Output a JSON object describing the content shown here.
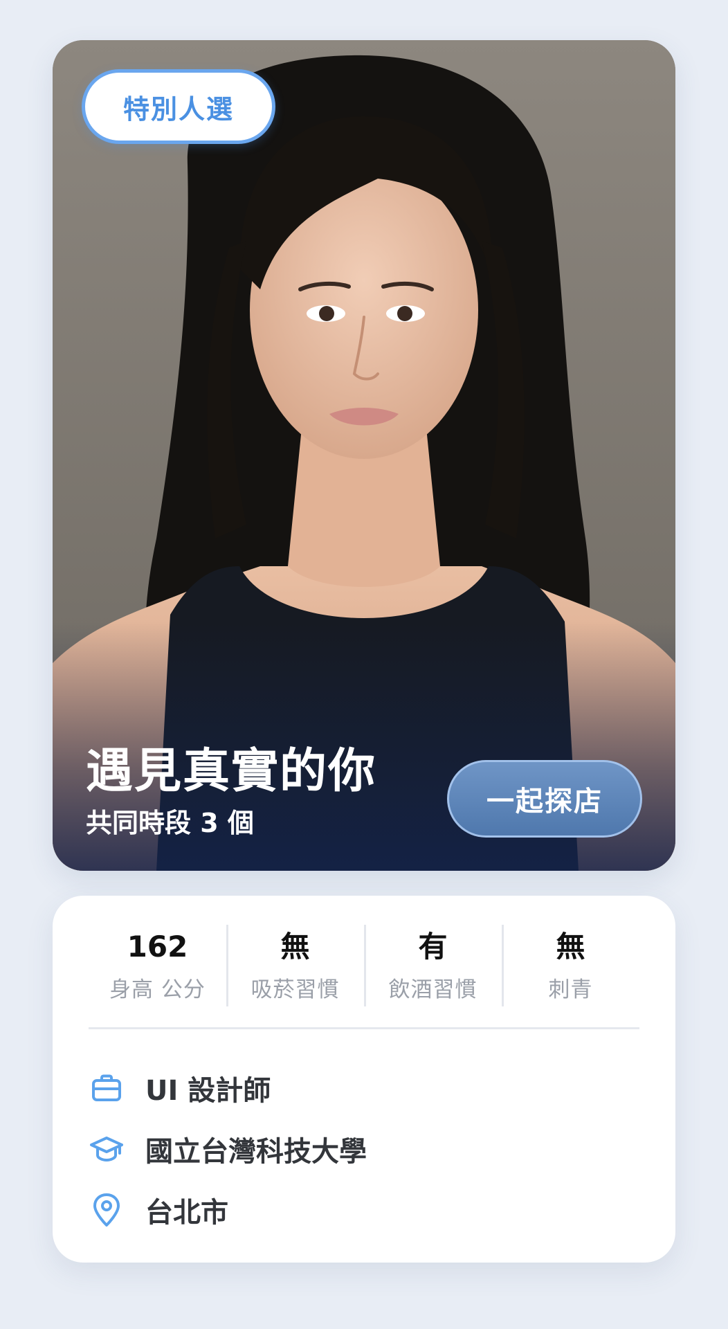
{
  "photo_card": {
    "badge_label": "特別人選",
    "headline": "遇見真實的你",
    "subline": "共同時段 3 個",
    "cta_label": "一起探店"
  },
  "stats": [
    {
      "value": "162",
      "label": "身高 公分"
    },
    {
      "value": "無",
      "label": "吸菸習慣"
    },
    {
      "value": "有",
      "label": "飲酒習慣"
    },
    {
      "value": "無",
      "label": "刺青"
    }
  ],
  "details": {
    "job": {
      "icon": "briefcase-icon",
      "text": "UI 設計師"
    },
    "school": {
      "icon": "graduation-cap-icon",
      "text": "國立台灣科技大學"
    },
    "location": {
      "icon": "location-pin-icon",
      "text": "台北市"
    }
  },
  "colors": {
    "accent": "#4a90e2",
    "cta": "#5a82b6",
    "background": "#e8edf5"
  }
}
